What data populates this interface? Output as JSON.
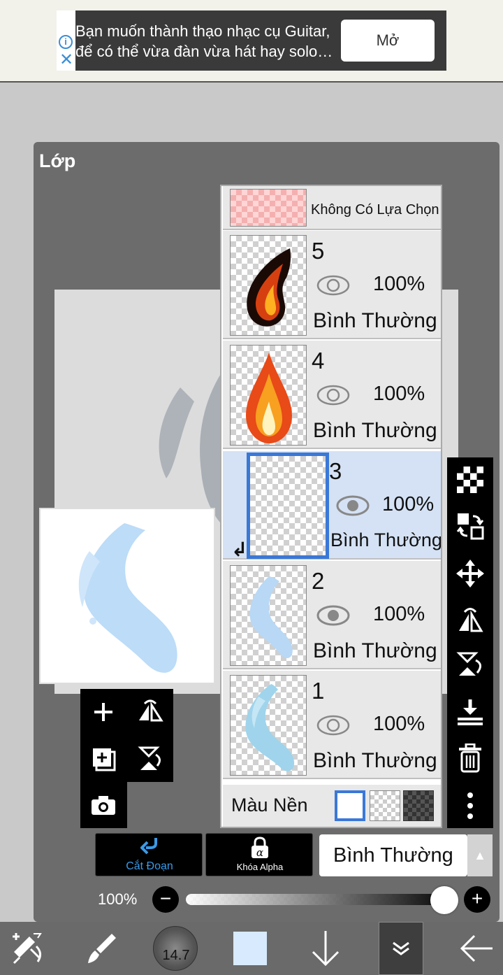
{
  "ad": {
    "text_line1": "Bạn muốn thành thạo nhạc cụ Guitar,",
    "text_line2": "để có thể vừa đàn vừa hát hay solo…",
    "open_label": "Mở",
    "info_icon": "info-icon",
    "close_icon": "close-icon"
  },
  "panel": {
    "title": "Lớp"
  },
  "selection_row": {
    "label": "Không Có Lựa Chọn"
  },
  "layers": [
    {
      "number": "5",
      "opacity": "100%",
      "blend": "Bình Thường"
    },
    {
      "number": "4",
      "opacity": "100%",
      "blend": "Bình Thường"
    },
    {
      "number": "3",
      "opacity": "100%",
      "blend": "Bình Thường"
    },
    {
      "number": "2",
      "opacity": "100%",
      "blend": "Bình Thường"
    },
    {
      "number": "1",
      "opacity": "100%",
      "blend": "Bình Thường"
    }
  ],
  "background": {
    "label": "Màu Nền"
  },
  "bottom_controls": {
    "clipping_label": "Cắt Đoạn",
    "alpha_lock_label": "Khóa Alpha",
    "blend_mode": "Bình Thường",
    "opacity_label": "100%",
    "minus": "−",
    "plus": "+",
    "opacity_value": 1.0
  },
  "nav": {
    "brush_size": "14.7"
  },
  "colors": {
    "accent": "#3a78d8",
    "selected_row": "#d5e2f5",
    "current_color": "#d8eafd"
  }
}
